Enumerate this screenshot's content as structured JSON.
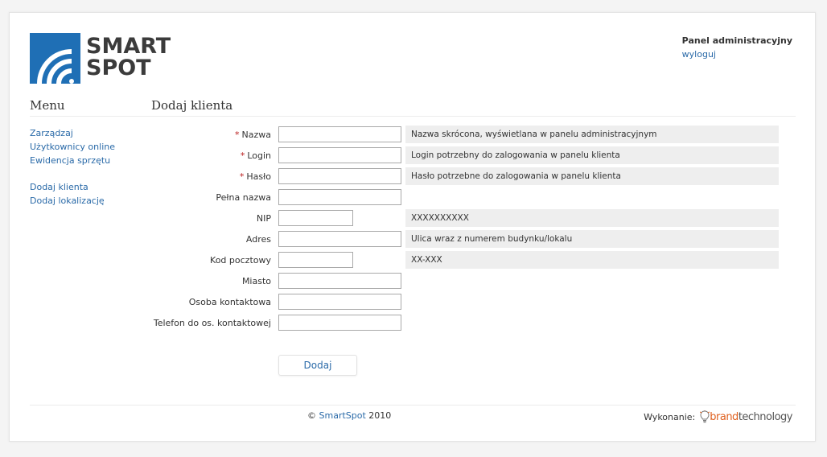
{
  "header": {
    "logo_line1": "SMART",
    "logo_line2": "SPOT",
    "panel_title": "Panel administracyjny",
    "logout_link": "wyloguj"
  },
  "sidebar": {
    "heading": "Menu",
    "group1": [
      "Zarządzaj",
      "Użytkownicy online",
      "Ewidencja sprzętu"
    ],
    "group2": [
      "Dodaj klienta",
      "Dodaj lokalizację"
    ]
  },
  "main": {
    "heading": "Dodaj klienta",
    "required_mark": "*",
    "fields": [
      {
        "label": "Nazwa",
        "required": true,
        "value": "",
        "hint": "Nazwa skrócona, wyświetlana w panelu administracyjnym"
      },
      {
        "label": "Login",
        "required": true,
        "value": "",
        "hint": "Login potrzebny do zalogowania w panelu klienta"
      },
      {
        "label": "Hasło",
        "required": true,
        "value": "",
        "hint": "Hasło potrzebne do zalogowania w panelu klienta"
      },
      {
        "label": "Pełna nazwa",
        "required": false,
        "value": "",
        "hint": ""
      },
      {
        "label": "NIP",
        "required": false,
        "value": "",
        "hint": "XXXXXXXXXX"
      },
      {
        "label": "Adres",
        "required": false,
        "value": "",
        "hint": "Ulica wraz z numerem budynku/lokalu"
      },
      {
        "label": "Kod pocztowy",
        "required": false,
        "value": "",
        "hint": "XX-XXX"
      },
      {
        "label": "Miasto",
        "required": false,
        "value": "",
        "hint": ""
      },
      {
        "label": "Osoba kontaktowa",
        "required": false,
        "value": "",
        "hint": ""
      },
      {
        "label": "Telefon do os. kontaktowej",
        "required": false,
        "value": "",
        "hint": ""
      }
    ],
    "submit_label": "Dodaj"
  },
  "footer": {
    "copyright_symbol": "©",
    "copyright_link": "SmartSpot",
    "copyright_year": "2010",
    "credit_label": "Wykonanie:",
    "brand_part1": "brand",
    "brand_part2": "technology"
  },
  "colors": {
    "logo_blue": "#1f6fb5",
    "link": "#2a6aa8",
    "required": "#b22222",
    "hint_bg": "#eeeeee",
    "brand_orange": "#e0611f"
  }
}
